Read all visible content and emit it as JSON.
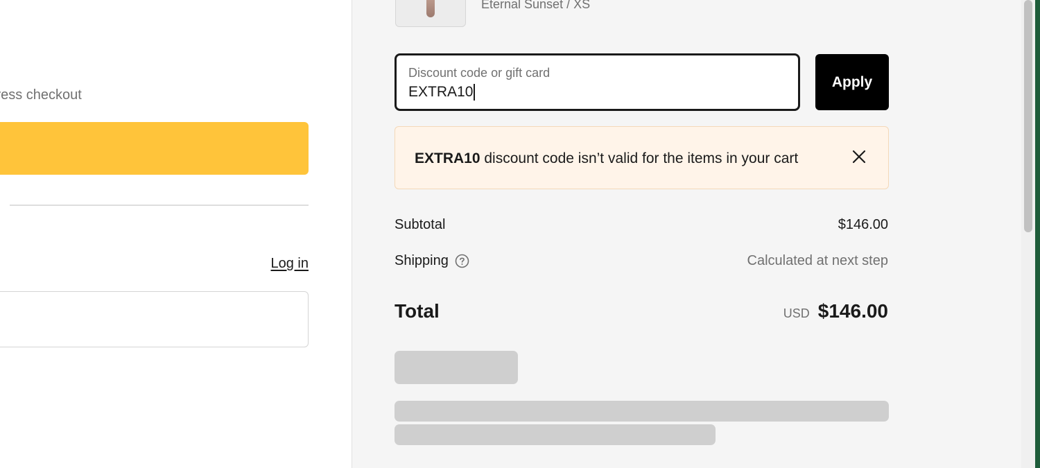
{
  "left": {
    "express_checkout_label": "Express checkout",
    "login_link": "Log in"
  },
  "order_summary": {
    "product": {
      "variant": "Eternal Sunset / XS"
    },
    "discount": {
      "placeholder": "Discount code or gift card",
      "value": "EXTRA10",
      "apply_label": "Apply"
    },
    "alert": {
      "code": "EXTRA10",
      "message": " discount code isn’t valid for the items in your cart"
    },
    "subtotal": {
      "label": "Subtotal",
      "value": "$146.00"
    },
    "shipping": {
      "label": "Shipping",
      "value": "Calculated at next step"
    },
    "total": {
      "label": "Total",
      "currency": "USD",
      "value": "$146.00"
    }
  },
  "colors": {
    "express_button": "#ffc43a",
    "alert_background": "#fff4e9",
    "apply_button": "#000000",
    "summary_background": "#f5f5f5"
  },
  "icons": [
    "close-icon",
    "help-icon"
  ]
}
